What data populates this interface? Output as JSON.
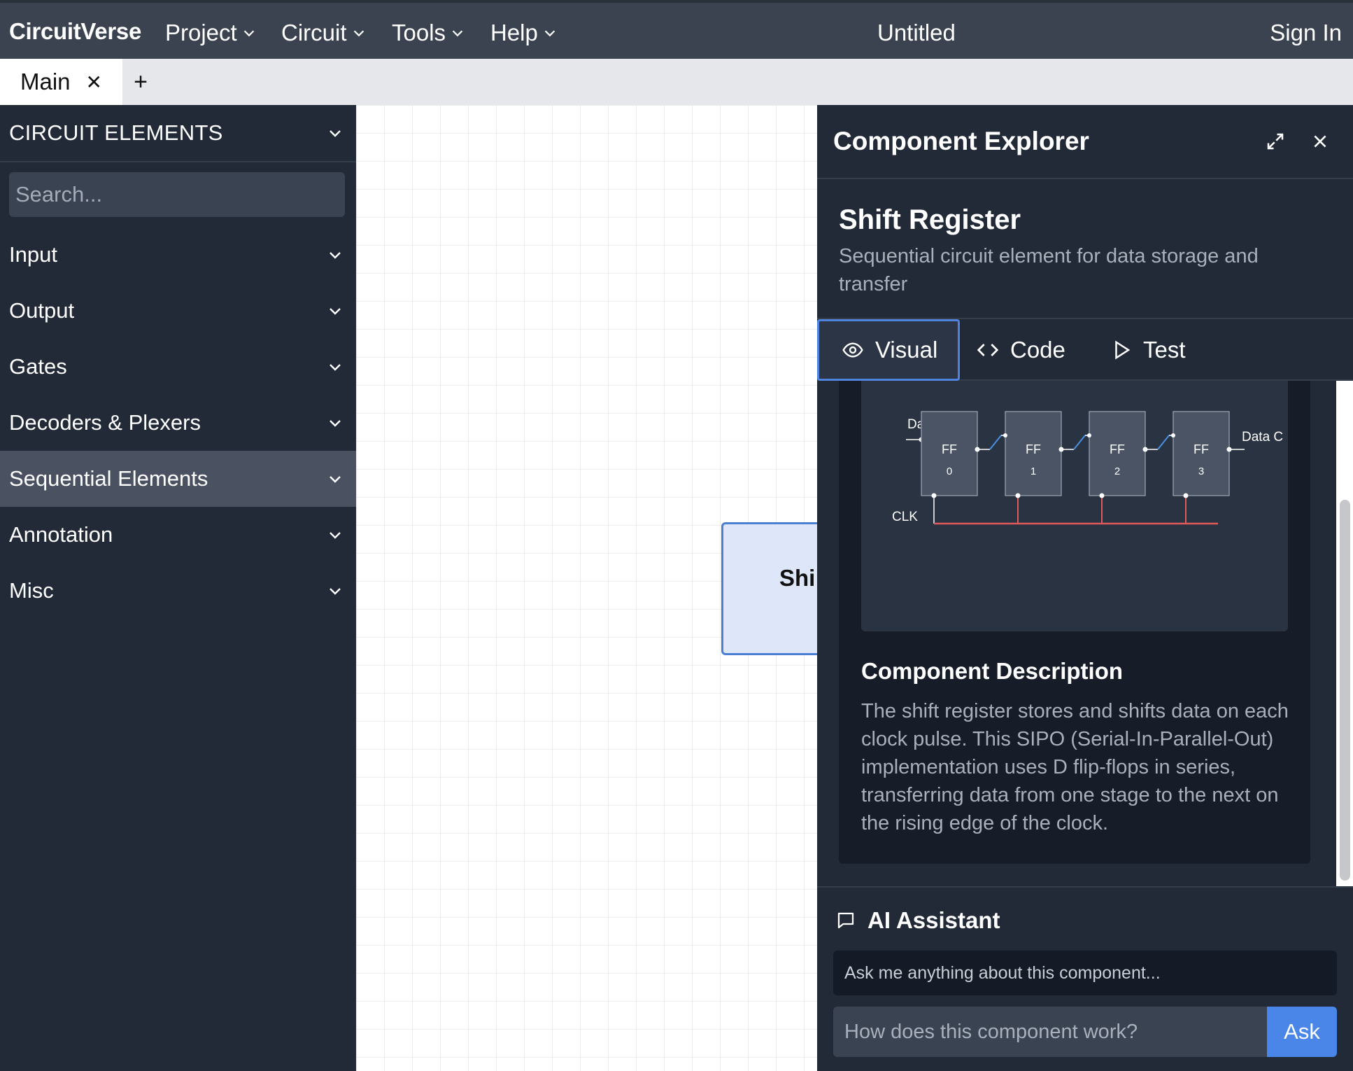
{
  "navbar": {
    "brand": "CircuitVerse",
    "menus": [
      "Project",
      "Circuit",
      "Tools",
      "Help"
    ],
    "title": "Untitled",
    "signin": "Sign In"
  },
  "tabs": {
    "main_label": "Main",
    "close_glyph": "✕",
    "add_glyph": "+"
  },
  "sidebar": {
    "header": "CIRCUIT ELEMENTS",
    "search_placeholder": "Search...",
    "items": [
      {
        "label": "Input"
      },
      {
        "label": "Output"
      },
      {
        "label": "Gates"
      },
      {
        "label": "Decoders & Plexers"
      },
      {
        "label": "Sequential Elements",
        "active": true
      },
      {
        "label": "Annotation"
      },
      {
        "label": "Misc"
      }
    ]
  },
  "canvas": {
    "block_label": "Shi"
  },
  "panel": {
    "title": "Component Explorer",
    "component_name": "Shift Register",
    "component_subtitle": "Sequential circuit element for data storage and transfer",
    "tabs": [
      {
        "label": "Visual",
        "icon": "eye-icon",
        "active": true
      },
      {
        "label": "Code",
        "icon": "code-icon"
      },
      {
        "label": "Test",
        "icon": "play-icon"
      }
    ],
    "diagram": {
      "data_in": "Data In",
      "data_out": "Data C",
      "clk": "CLK",
      "ff_label": "FF",
      "stages": [
        "0",
        "1",
        "2",
        "3"
      ],
      "clock_color": "#e05a5a",
      "link_color": "#4a90e2"
    },
    "description_title": "Component Description",
    "description": "The shift register stores and shifts data on each clock pulse. This SIPO (Serial-In-Parallel-Out) implementation uses D flip-flops in series, transferring data from one stage to the next on the rising edge of the clock.",
    "ai": {
      "title": "AI Assistant",
      "message": "Ask me anything about this component...",
      "input_placeholder": "How does this component work?",
      "button": "Ask"
    }
  },
  "colors": {
    "navbar": "#3b4350",
    "sidebar": "#222a38",
    "accent": "#4a86e8"
  }
}
